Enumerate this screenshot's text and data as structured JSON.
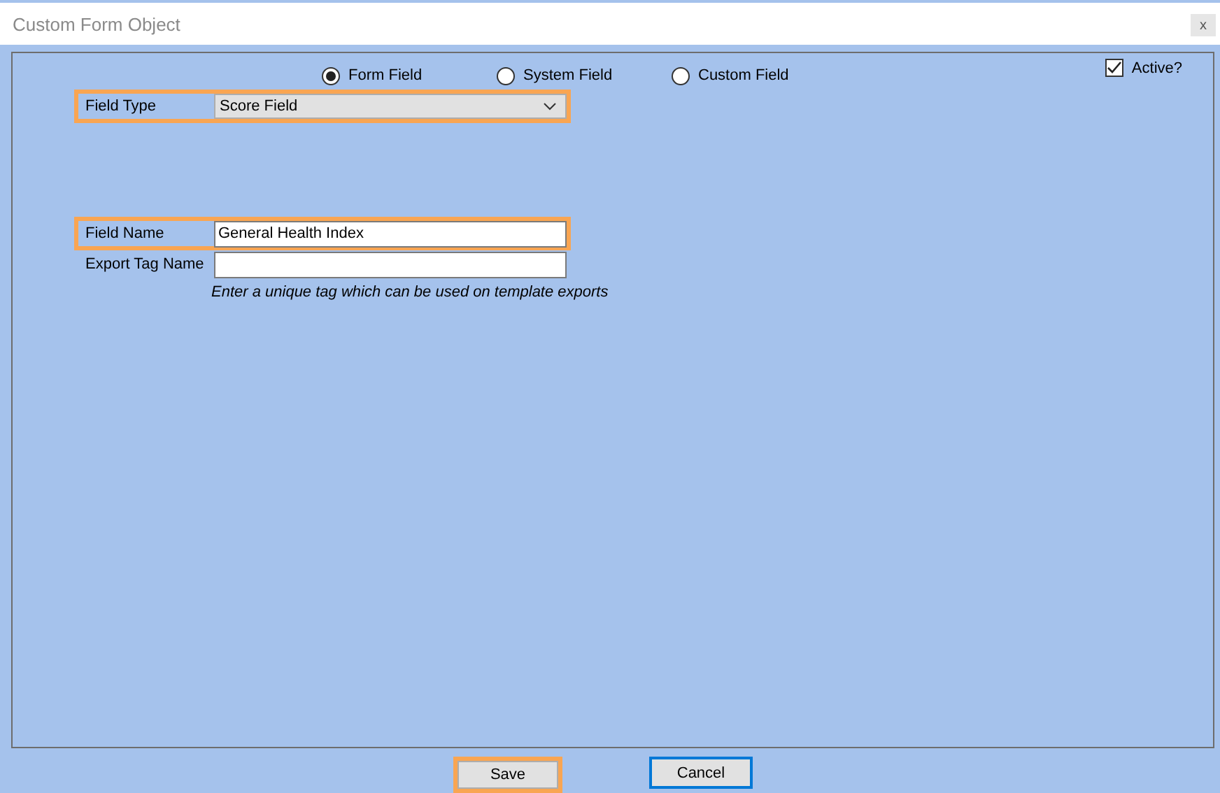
{
  "window": {
    "title": "Custom Form Object",
    "close": "x"
  },
  "source_options": [
    {
      "label": "Form Field",
      "selected": true
    },
    {
      "label": "System Field",
      "selected": false
    },
    {
      "label": "Custom Field",
      "selected": false
    }
  ],
  "active": {
    "label": "Active?",
    "checked": true
  },
  "field_type": {
    "label": "Field Type",
    "value": "Score Field",
    "highlighted": true
  },
  "field_name": {
    "label": "Field Name",
    "value": "General Health Index",
    "highlighted": true
  },
  "export_tag": {
    "label": "Export Tag Name",
    "highlighted": false,
    "hint": "Enter a unique tag which can be used on template exports"
  },
  "buttons": [
    {
      "label": "Save",
      "highlighted": true,
      "focused": false
    },
    {
      "label": "Cancel",
      "highlighted": false,
      "focused": true
    }
  ]
}
